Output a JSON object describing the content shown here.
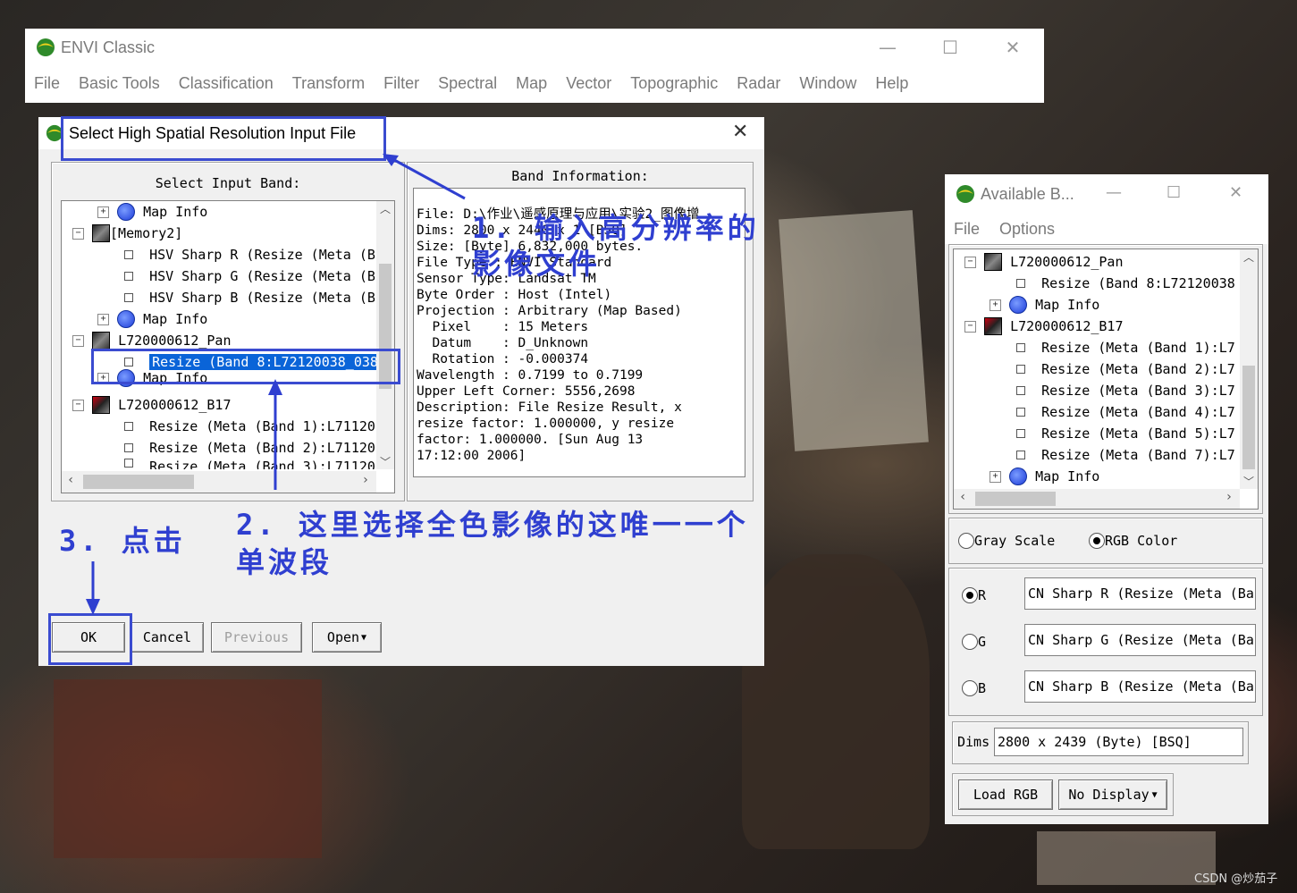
{
  "main_window": {
    "title": "ENVI Classic",
    "menu": [
      "File",
      "Basic Tools",
      "Classification",
      "Transform",
      "Filter",
      "Spectral",
      "Map",
      "Vector",
      "Topographic",
      "Radar",
      "Window",
      "Help"
    ]
  },
  "dialog": {
    "title": "Select High Spatial Resolution Input File",
    "select_band_label": "Select Input Band:",
    "band_info_label": "Band Information:",
    "tree": [
      {
        "label": "Map Info",
        "type": "map"
      },
      {
        "label": "[Memory2]",
        "type": "file"
      },
      {
        "label": "HSV Sharp R (Resize (Meta (B",
        "type": "band"
      },
      {
        "label": "HSV Sharp G (Resize (Meta (B",
        "type": "band"
      },
      {
        "label": "HSV Sharp B (Resize (Meta (B",
        "type": "band"
      },
      {
        "label": "Map Info",
        "type": "map"
      },
      {
        "label": "L720000612_Pan",
        "type": "file"
      },
      {
        "label": "Resize (Band 8:L72120038_038",
        "type": "band",
        "selected": true
      },
      {
        "label": "Map Info",
        "type": "map"
      },
      {
        "label": "L720000612_B17",
        "type": "file"
      },
      {
        "label": "Resize (Meta (Band 1):L71120",
        "type": "band"
      },
      {
        "label": "Resize (Meta (Band 2):L71120",
        "type": "band"
      },
      {
        "label": "Resize (Meta (Band 3):L71120",
        "type": "band"
      }
    ],
    "info_lines": [
      "File: D:\\作业\\遥感原理与应用\\实验2_图像增",
      "Dims: 2800 x 2440 x 1 [BSQ]",
      "Size: [Byte] 6,832,000 bytes.",
      "File Type : ENVI Standard",
      "Sensor Type: Landsat TM",
      "Byte Order : Host (Intel)",
      "Projection : Arbitrary (Map Based)",
      "  Pixel    : 15 Meters",
      "  Datum    : D_Unknown",
      "  Rotation : -0.000374",
      "Wavelength : 0.7199 to 0.7199",
      "Upper Left Corner: 5556,2698",
      "Description: File Resize Result, x",
      "resize factor: 1.000000, y resize",
      "factor: 1.000000. [Sun Aug 13",
      "17:12:00 2006]"
    ],
    "buttons": {
      "ok": "OK",
      "cancel": "Cancel",
      "previous": "Previous",
      "open": "Open"
    }
  },
  "annotations": {
    "a1_line1": "1. 输入高分辨率的",
    "a1_line2": "影像文件",
    "a2_line1": "2. 这里选择全色影像的这唯一一个",
    "a2_line2": "单波段",
    "a3": "3. 点击"
  },
  "available_bands": {
    "title": "Available B...",
    "menu": [
      "File",
      "Options"
    ],
    "tree": [
      {
        "label": "L720000612_Pan",
        "type": "file"
      },
      {
        "label": "Resize (Band 8:L72120038",
        "type": "band"
      },
      {
        "label": "Map Info",
        "type": "map"
      },
      {
        "label": "L720000612_B17",
        "type": "file"
      },
      {
        "label": "Resize (Meta (Band 1):L7",
        "type": "band"
      },
      {
        "label": "Resize (Meta (Band 2):L7",
        "type": "band"
      },
      {
        "label": "Resize (Meta (Band 3):L7",
        "type": "band"
      },
      {
        "label": "Resize (Meta (Band 4):L7",
        "type": "band"
      },
      {
        "label": "Resize (Meta (Band 5):L7",
        "type": "band"
      },
      {
        "label": "Resize (Meta (Band 7):L7",
        "type": "band"
      },
      {
        "label": "Map Info",
        "type": "map"
      }
    ],
    "gray_scale": "Gray Scale",
    "rgb_color": "RGB Color",
    "channels": [
      {
        "label": "R",
        "value": "CN Sharp R (Resize (Meta (Ba"
      },
      {
        "label": "G",
        "value": "CN Sharp G (Resize (Meta (Ba"
      },
      {
        "label": "B",
        "value": "CN Sharp B (Resize (Meta (Ba"
      }
    ],
    "dims_label": "Dims",
    "dims_value": "2800 x 2439 (Byte) [BSQ]",
    "load_rgb": "Load RGB",
    "no_display": "No Display"
  },
  "watermark": "CSDN @炒茄子"
}
